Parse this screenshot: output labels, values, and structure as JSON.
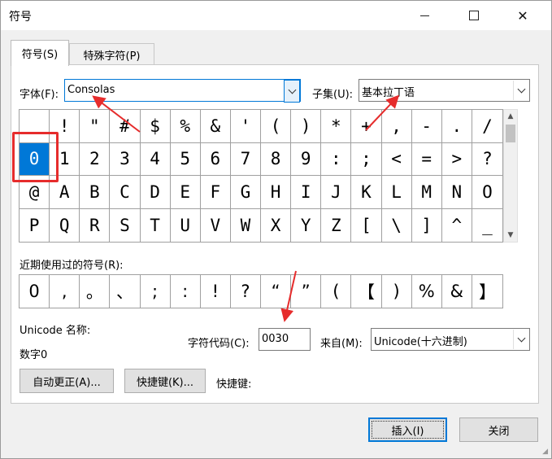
{
  "window": {
    "title": "符号"
  },
  "tabs": [
    {
      "label": "符号(S)",
      "active": true
    },
    {
      "label": "特殊字符(P)",
      "active": false
    }
  ],
  "font": {
    "label": "字体(F):",
    "value": "Consolas"
  },
  "subset": {
    "label": "子集(U):",
    "value": "基本拉丁语"
  },
  "symbol_grid": {
    "rows": [
      [
        " ",
        "!",
        "\"",
        "#",
        "$",
        "%",
        "&",
        "'",
        "(",
        ")",
        "*",
        "+",
        ",",
        "-",
        ".",
        "/"
      ],
      [
        "0",
        "1",
        "2",
        "3",
        "4",
        "5",
        "6",
        "7",
        "8",
        "9",
        ":",
        ";",
        "<",
        "=",
        ">",
        "?"
      ],
      [
        "@",
        "A",
        "B",
        "C",
        "D",
        "E",
        "F",
        "G",
        "H",
        "I",
        "J",
        "K",
        "L",
        "M",
        "N",
        "O"
      ],
      [
        "P",
        "Q",
        "R",
        "S",
        "T",
        "U",
        "V",
        "W",
        "X",
        "Y",
        "Z",
        "[",
        "\\",
        "]",
        "^",
        "_"
      ]
    ],
    "selected": "0"
  },
  "recent": {
    "label": "近期使用过的符号(R):",
    "symbols": [
      "0",
      ",",
      "。",
      "、",
      ";",
      ":",
      "!",
      "?",
      "“",
      "”",
      "(",
      "【",
      ")",
      "%",
      "&",
      "】"
    ]
  },
  "unicode_name": {
    "label": "Unicode 名称:",
    "value": "数字0"
  },
  "char_code": {
    "label": "字符代码(C):",
    "value": "0030"
  },
  "from": {
    "label": "来自(M):",
    "value": "Unicode(十六进制)"
  },
  "buttons": {
    "autocorrect": "自动更正(A)...",
    "shortcut_key": "快捷键(K)...",
    "shortcut_label": "快捷键:",
    "insert": "插入(I)",
    "close": "关闭"
  },
  "colors": {
    "selection": "#0078d7",
    "annotation": "#e62c2c"
  }
}
